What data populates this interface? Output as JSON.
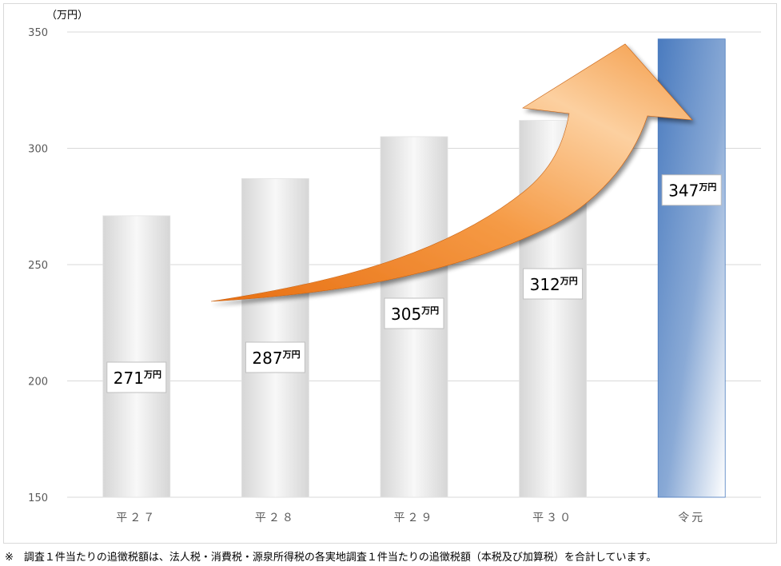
{
  "footnote": "※　調査１件当たりの追徴税額は、法人税・消費税・源泉所得税の各実地調査１件当たりの追徴税額（本税及び加算税）を合計しています。",
  "chart_data": {
    "type": "bar",
    "unit_label": "（万円）",
    "categories": [
      "平２７",
      "平２８",
      "平２９",
      "平３０",
      "令元"
    ],
    "values": [
      271,
      287,
      305,
      312,
      347
    ],
    "data_labels": [
      "271",
      "287",
      "305",
      "312",
      "347"
    ],
    "data_label_unit": "万円",
    "yticks": [
      "150",
      "200",
      "250",
      "300",
      "350"
    ],
    "ylim": [
      150,
      350
    ],
    "grid": true,
    "highlight_index": 4,
    "colors": {
      "bar_gray_edge": "#d9d9d9",
      "bar_gray_light": "#f7f7f7",
      "bar_blue_top": "#4f7fc0",
      "bar_blue_bottom": "#ffffff",
      "arrow_orange": "#f28a2e",
      "arrow_light": "#fbd2a6",
      "grid": "#d9d9d9",
      "tick_text": "#595959"
    }
  }
}
